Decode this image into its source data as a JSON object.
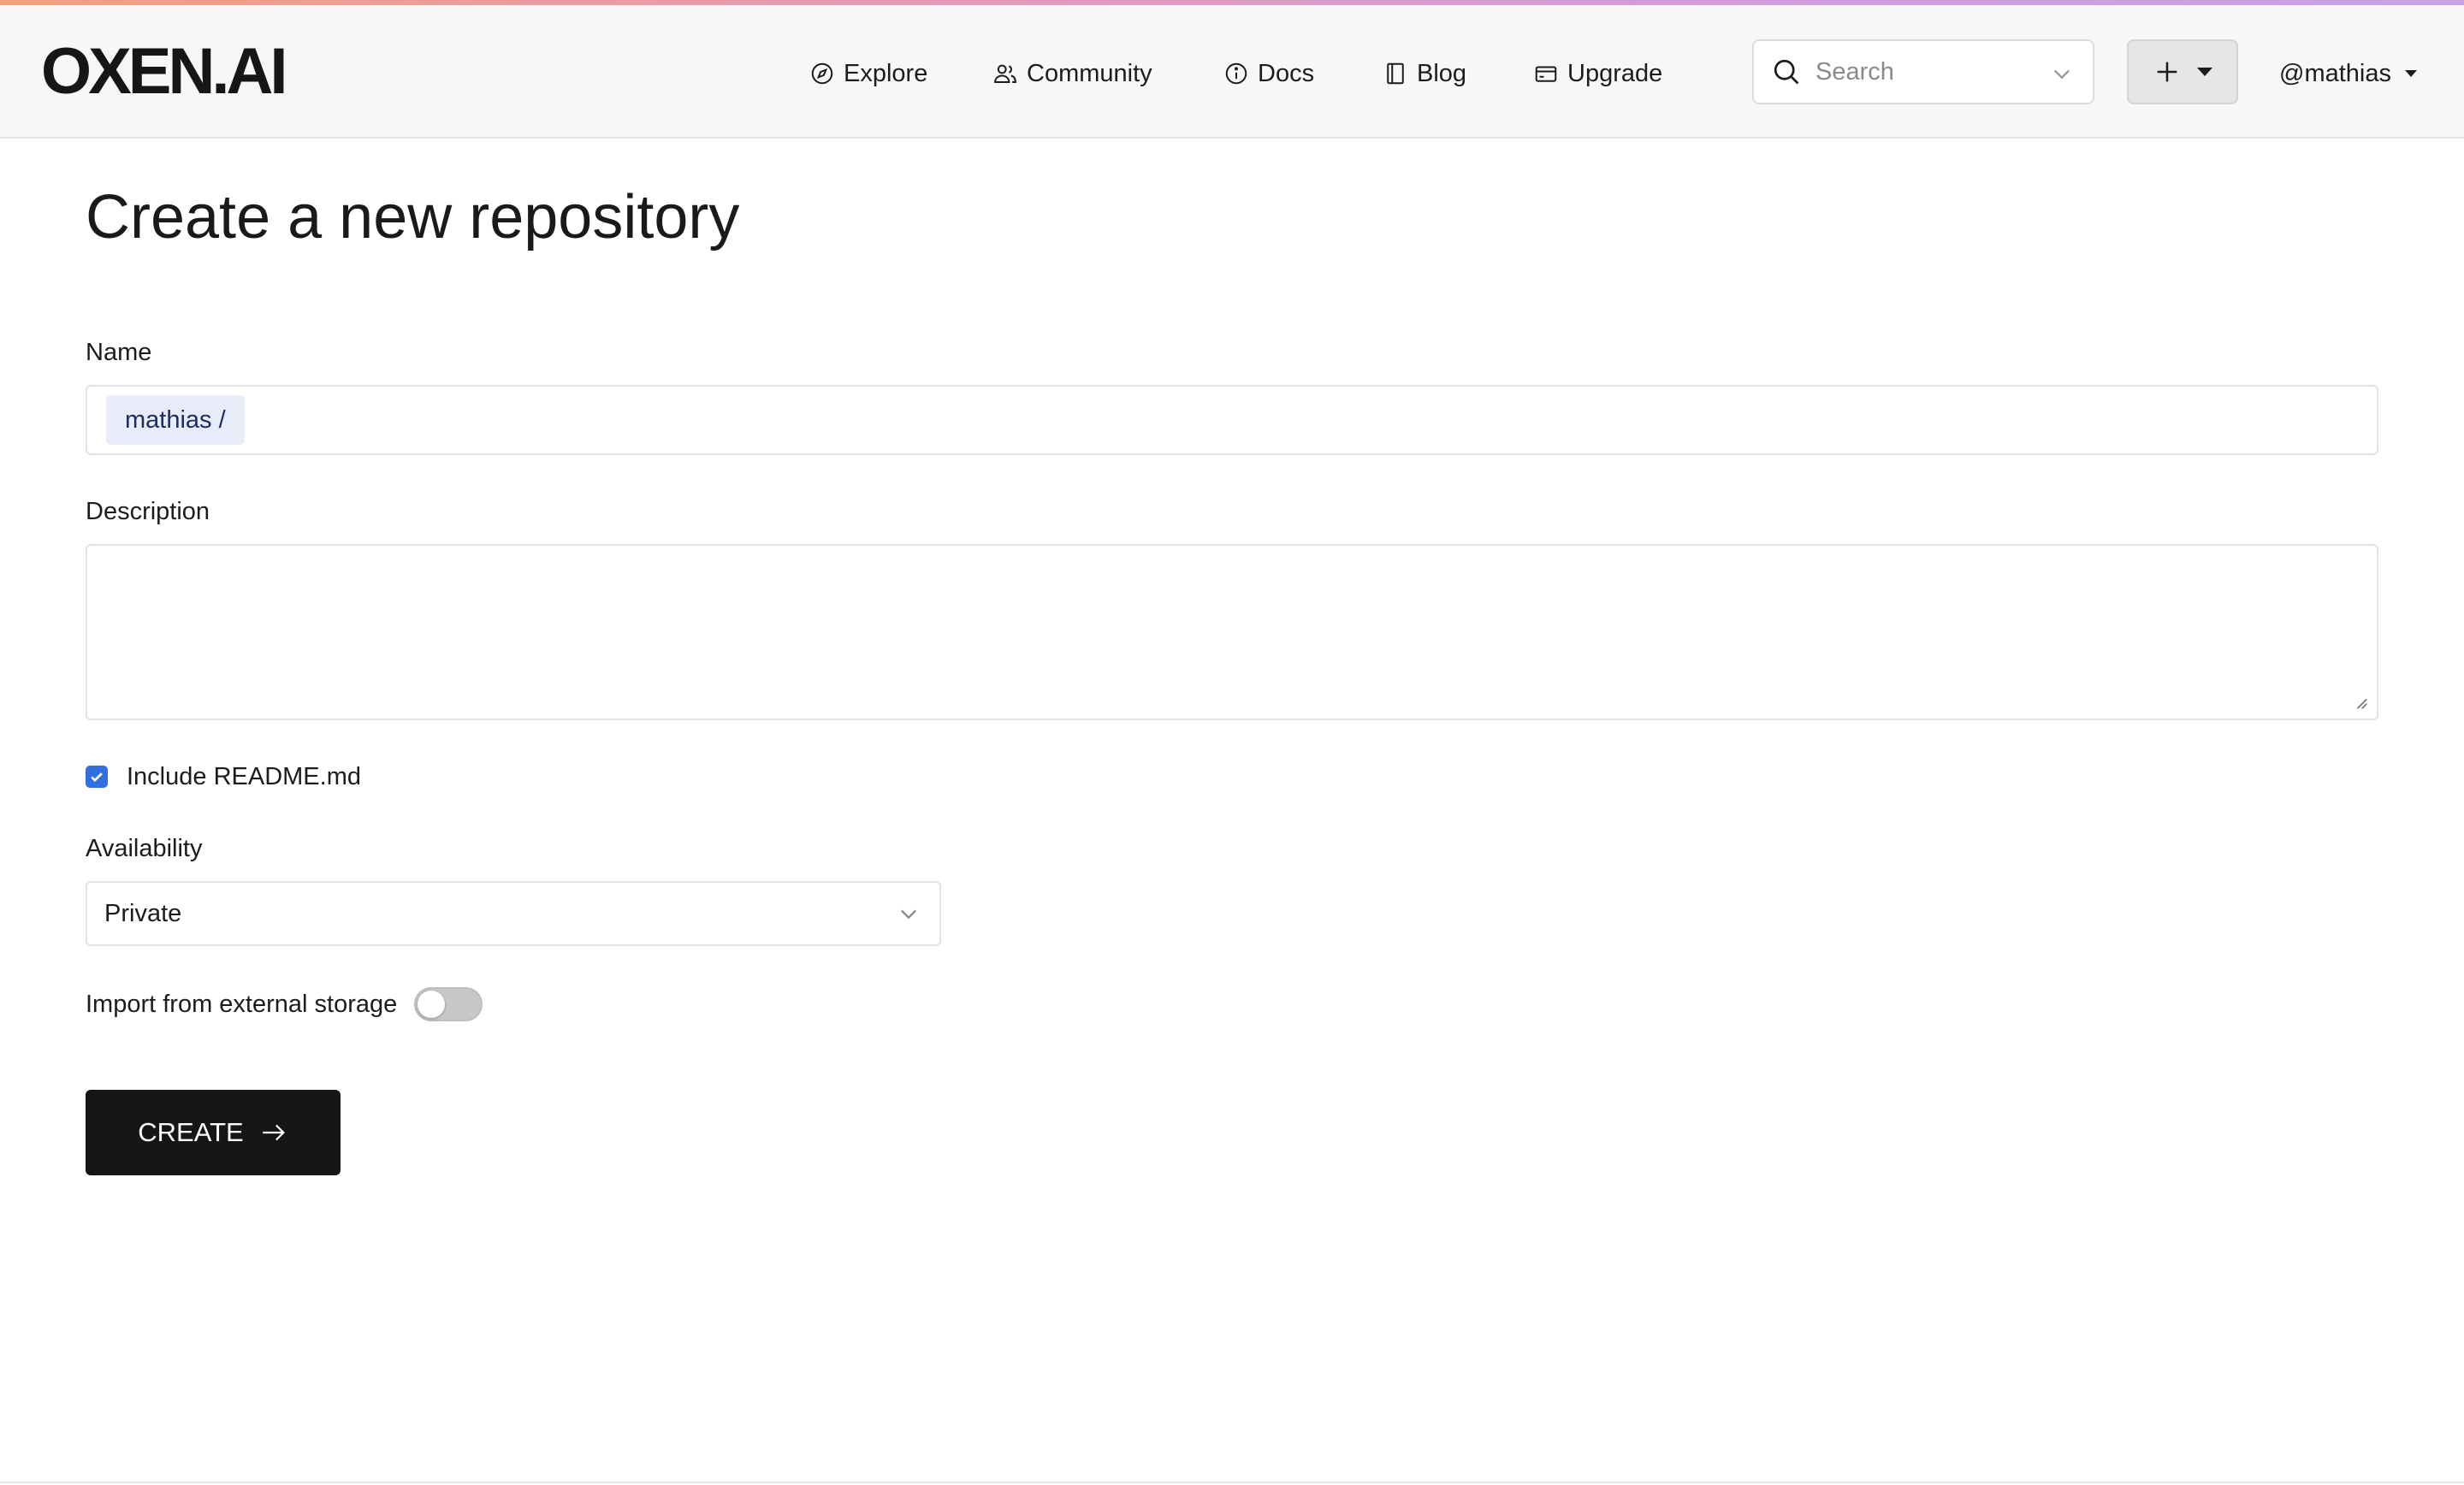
{
  "header": {
    "logo": "OXEN.AI",
    "nav": [
      {
        "label": "Explore",
        "icon": "compass-icon"
      },
      {
        "label": "Community",
        "icon": "users-icon"
      },
      {
        "label": "Docs",
        "icon": "info-icon"
      },
      {
        "label": "Blog",
        "icon": "book-icon"
      },
      {
        "label": "Upgrade",
        "icon": "credit-card-icon"
      }
    ],
    "search": {
      "placeholder": "Search"
    },
    "user": "@mathias"
  },
  "page": {
    "title": "Create a new repository"
  },
  "form": {
    "name_label": "Name",
    "name_prefix": "mathias /",
    "name_value": "",
    "description_label": "Description",
    "description_value": "",
    "readme_label": "Include README.md",
    "readme_checked": true,
    "availability_label": "Availability",
    "availability_value": "Private",
    "import_label": "Import from external storage",
    "import_enabled": false,
    "create_label": "CREATE"
  },
  "colors": {
    "accent_gradient": [
      "#f0a07c",
      "#e59ab2",
      "#d59ad8",
      "#c7a0e6"
    ],
    "checkbox": "#2f6fe0",
    "button_bg": "#161616",
    "prefix_bg": "#e8ecf8"
  }
}
